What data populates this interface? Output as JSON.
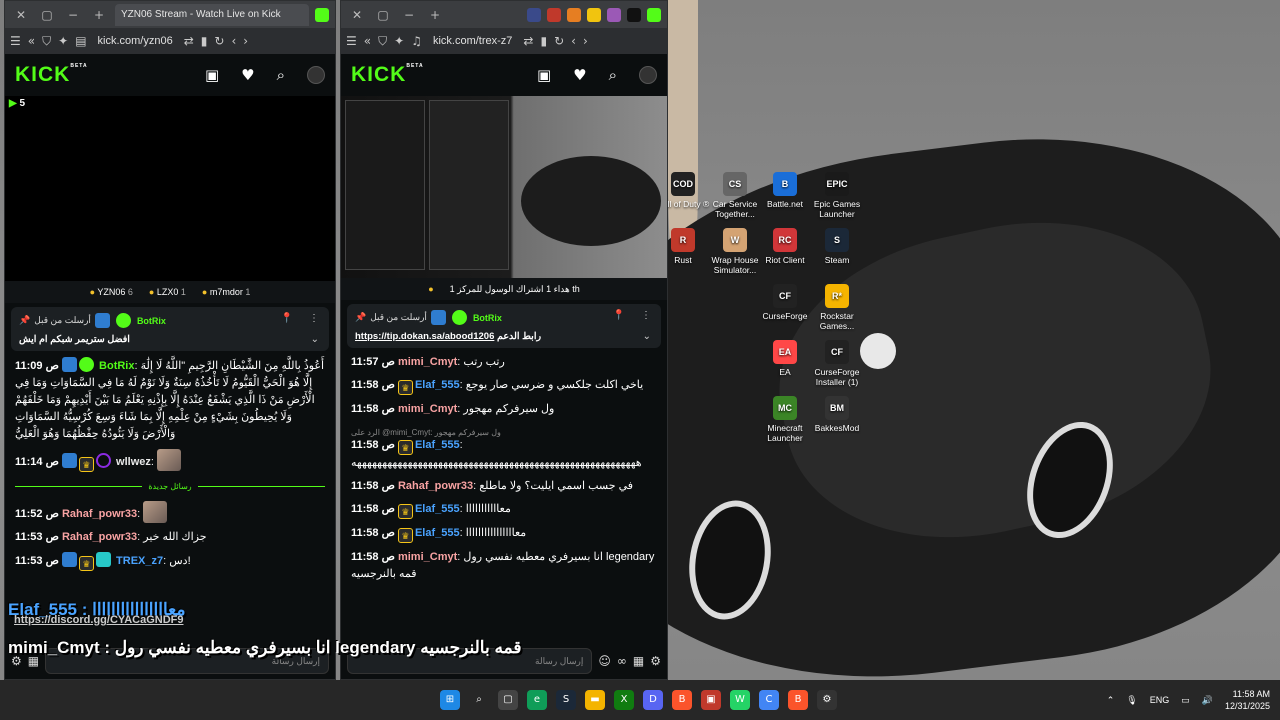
{
  "desktop": {
    "icons": [
      {
        "label": "Call of Duty ®",
        "glyph": "COD",
        "color": "#222"
      },
      {
        "label": "Car Service Together...",
        "glyph": "CS",
        "color": "#666"
      },
      {
        "label": "Battle.net",
        "glyph": "B",
        "color": "#1a6ed8"
      },
      {
        "label": "Epic Games Launcher",
        "glyph": "EPIC",
        "color": "#1a1a1a"
      },
      {
        "label": "Rust",
        "glyph": "R",
        "color": "#c0392b"
      },
      {
        "label": "Wrap House Simulator...",
        "glyph": "W",
        "color": "#d4a373"
      },
      {
        "label": "Riot Client",
        "glyph": "RC",
        "color": "#d13639"
      },
      {
        "label": "Steam",
        "glyph": "S",
        "color": "#1b2838"
      },
      {
        "label": "CurseForge",
        "glyph": "CF",
        "color": "#222"
      },
      {
        "label": "Rockstar Games...",
        "glyph": "R*",
        "color": "#f5b400"
      },
      {
        "label": "EA",
        "glyph": "EA",
        "color": "#ff4747"
      },
      {
        "label": "CurseForge Installer (1)",
        "glyph": "CF",
        "color": "#222"
      },
      {
        "label": "Minecraft Launcher",
        "glyph": "MC",
        "color": "#3b8526"
      },
      {
        "label": "BakkesMod",
        "glyph": "BM",
        "color": "#333"
      }
    ]
  },
  "browser1": {
    "tab_title": "YZN06 Stream - Watch Live on Kick",
    "url": "kick.com/yzn06",
    "viewer_count": "5",
    "top_gifters": [
      {
        "name": "YZN06",
        "count": "6"
      },
      {
        "name": "LZX0",
        "count": "1"
      },
      {
        "name": "m7mdor",
        "count": "1"
      }
    ],
    "pinned": {
      "header": "أرسلت من قبل",
      "bot": "BotRix",
      "message": "افضل ستريمر شبكم ام ايش"
    },
    "messages": [
      {
        "time": "11:09 ص",
        "user": "BotRix",
        "user_color": "#53fc18",
        "text": "أَعُوذُ بِاللَّهِ مِنَ الشَّيْطَانِ الرَّجِيمِ \"اللَّهُ لَا إِلَٰهَ إِلَّا هُوَ الْحَيُّ الْقَيُّومُ لَا تَأْخُذُهُ سِنَةٌ وَلَا نَوْمٌ لَهُ مَا فِي السَّمَاوَاتِ وَمَا فِي الْأَرْضِ مَنْ ذَا الَّذِي يَشْفَعُ عِنْدَهُ إِلَّا بِإِذْنِهِ يَعْلَمُ مَا بَيْنَ أَيْدِيهِمْ وَمَا خَلْفَهُمْ وَلَا يُحِيطُونَ بِشَيْءٍ مِنْ عِلْمِهِ إِلَّا بِمَا شَاءَ وَسِعَ كُرْسِيُّهُ السَّمَاوَاتِ وَالْأَرْضَ وَلَا يَئُودُهُ حِفْظُهُمَا وَهُوَ الْعَلِيُّ"
      },
      {
        "time": "11:14 ص",
        "user": "wllwez",
        "user_color": "#ffffff",
        "text": ""
      }
    ],
    "divider": "رسائل جديدة",
    "messages2": [
      {
        "time": "11:52 ص",
        "user": "Rahaf_powr33",
        "user_color": "#f8a3a3",
        "text": ""
      },
      {
        "time": "11:53 ص",
        "user": "Rahaf_powr33",
        "user_color": "#f8a3a3",
        "text": "جزاك الله خير"
      },
      {
        "time": "11:53 ص",
        "user": "TREX_z7",
        "user_color": "#4aa3ff",
        "text": "دس!"
      }
    ],
    "overlay_line1": "Elaf_555 : معاااااااااااااااا",
    "overlay_link": "https://discord.gg/CYACaGNDF9",
    "overlay_line2": "mimi_Cmyt : انا بسيرفري معطيه نفسي رول legendary قمه بالنرجسيه",
    "input_placeholder": "إرسال رسالة"
  },
  "browser2": {
    "url": "kick.com/trex-z7",
    "goal_text": "هداء 1 اشتراك الوسول للمركز 1 th",
    "pinned": {
      "header": "أرسلت من قبل",
      "bot": "BotRix",
      "link": "https://tip.dokan.sa/abood1206",
      "link_label": "رابط الدعم"
    },
    "messages": [
      {
        "time": "11:57 ص",
        "user": "mimi_Cmyt",
        "user_color": "#f8a3a3",
        "text": "رتب رتب"
      },
      {
        "time": "11:58 ص",
        "user": "Elaf_555",
        "user_color": "#4aa3ff",
        "text": "ياخي اكلت جلكسي و ضرسي صار يوجع"
      },
      {
        "time": "11:58 ص",
        "user": "mimi_Cmyt",
        "user_color": "#f8a3a3",
        "text": "ول سيرفركم مهجور"
      },
      {
        "time": "11:58 ص",
        "user": "Elaf_555",
        "user_color": "#4aa3ff",
        "reply": "الرد على @mimi_Cmyt: ول سيرفركم مهجور",
        "text": "ههههههههههههههههههههههههههههههههههههههههههههههههههههههههه"
      },
      {
        "time": "11:58 ص",
        "user": "Rahaf_powr33",
        "user_color": "#f8a3a3",
        "text": "في جسب اسمي ايليت؟ ولا ماطلع"
      },
      {
        "time": "11:58 ص",
        "user": "Elaf_555",
        "user_color": "#4aa3ff",
        "text": "معااااااااااا"
      },
      {
        "time": "11:58 ص",
        "user": "Elaf_555",
        "user_color": "#4aa3ff",
        "text": "معاااااااااااااااا"
      },
      {
        "time": "11:58 ص",
        "user": "mimi_Cmyt",
        "user_color": "#f8a3a3",
        "text": "انا بسيرفري معطيه نفسي رول legendary قمه بالنرجسيه"
      }
    ],
    "input_placeholder": "إرسال رسالة"
  },
  "taskbar": {
    "lang": "ENG",
    "time": "11:58 AM",
    "date": "12/31/2025"
  }
}
